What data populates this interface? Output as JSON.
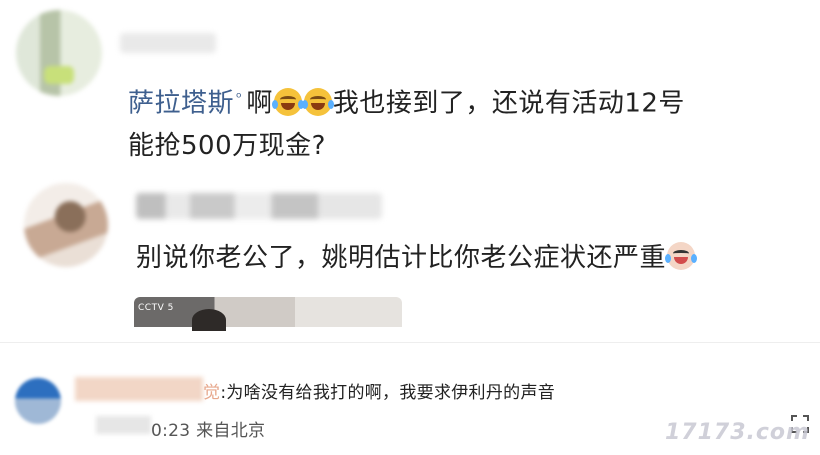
{
  "comments": [
    {
      "author": "萨拉塔斯",
      "tag_icon": "pin-icon",
      "text_lead": "啊",
      "text_after_emoji": "我也接到了，还说有活动12号",
      "text_line2": "能抢500万现金?",
      "emojis": [
        "laughing-crying-emoji",
        "laughing-crying-emoji"
      ]
    },
    {
      "text": "别说你老公了，姚明估计比你老公症状还严重",
      "emoji": "crying-emoji",
      "video_badge": "CCTV 5"
    }
  ],
  "reply": {
    "name_partial": "觉",
    "text": ":为啥没有给我打的啊，我要求伊利丹的声音",
    "time": "0:23",
    "location": "来自北京"
  },
  "watermark": "17173.com",
  "colors": {
    "author": "#3e5f8e",
    "emoji_face": "#f5c23b"
  }
}
